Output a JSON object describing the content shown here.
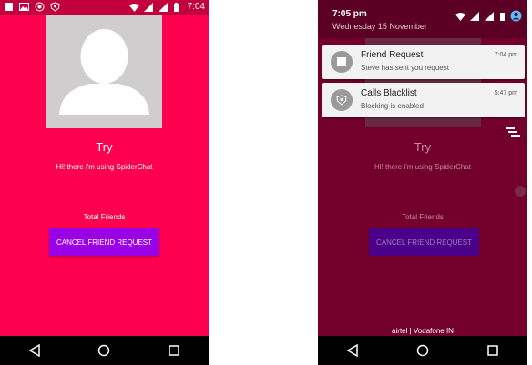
{
  "left_screen": {
    "status_bar": {
      "time": "7:04"
    },
    "profile": {
      "name": "Try",
      "status": "Hi! there i'm using SpiderChat",
      "friends_label": "Total Friends",
      "cancel_button": "CANCEL FRIEND REQUEST"
    }
  },
  "right_screen": {
    "shade": {
      "time": "7:05 pm",
      "date": "Wednesday 15 November"
    },
    "notifications": [
      {
        "title": "Friend Request",
        "subtitle": "Steve has sent you request",
        "time": "7:04 pm"
      },
      {
        "title": "Calls Blacklist",
        "subtitle": "Blocking is enabled",
        "time": "5:47 pm"
      }
    ],
    "profile": {
      "name": "Try",
      "status": "Hi! there i'm using SpiderChat",
      "friends_label": "Total Friends",
      "cancel_button": "CANCEL FRIEND REQUEST"
    },
    "carrier": "airtel | Vodafone IN"
  },
  "colors": {
    "primary": "#ff0050",
    "statusbar": "#c2003f",
    "button": "#9a00e6",
    "dim_bg": "#73002b"
  }
}
